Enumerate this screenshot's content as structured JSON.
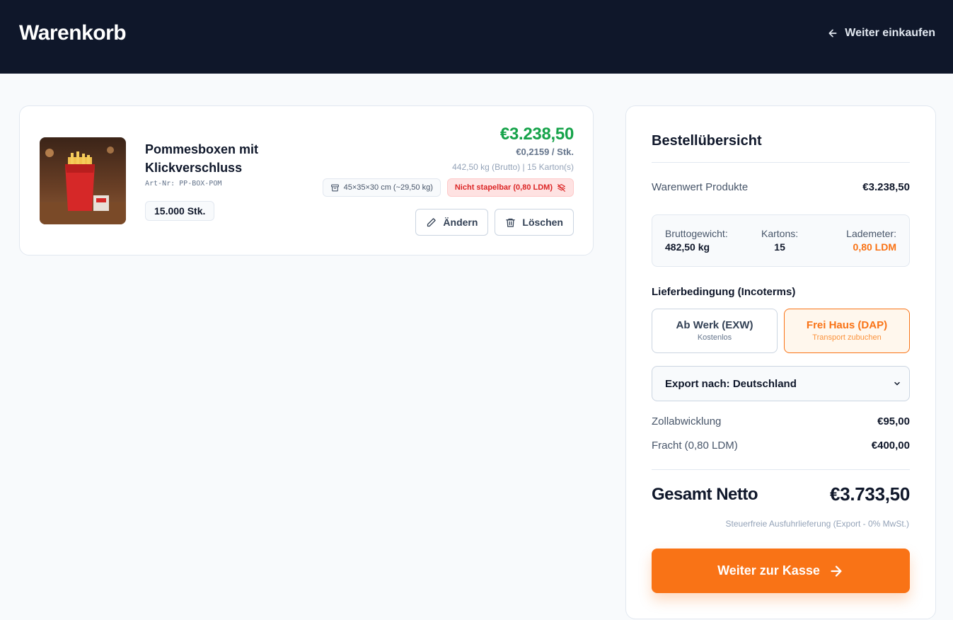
{
  "header": {
    "title": "Warenkorb",
    "back_label": "Weiter einkaufen"
  },
  "cart": {
    "items": [
      {
        "name": "Pommesboxen mit Klickverschluss",
        "sku": "Art-Nr: PP-BOX-POM",
        "quantity": "15.000 Stk.",
        "total_price": "€3.238,50",
        "unit_price": "€0,2159 / Stk.",
        "meta": "442,50 kg (Brutto) | 15 Karton(s)",
        "dimension_tag": "45×35×30 cm (~29,50 kg)",
        "warning_tag": "Nicht stapelbar (0,80 LDM)",
        "edit_label": "Ändern",
        "delete_label": "Löschen"
      }
    ]
  },
  "summary": {
    "title": "Bestellübersicht",
    "goods_label": "Warenwert Produkte",
    "goods_value": "€3.238,50",
    "stats": {
      "weight_label": "Bruttogewicht:",
      "weight_value": "482,50 kg",
      "cartons_label": "Kartons:",
      "cartons_value": "15",
      "ldm_label": "Lademeter:",
      "ldm_value": "0,80 LDM"
    },
    "incoterm_label": "Lieferbedingung (Incoterms)",
    "incoterms": [
      {
        "title": "Ab Werk (EXW)",
        "subtitle": "Kostenlos",
        "selected": false
      },
      {
        "title": "Frei Haus (DAP)",
        "subtitle": "Transport zubuchen",
        "selected": true
      }
    ],
    "export_select": "Export nach: Deutschland",
    "customs_label": "Zollabwicklung",
    "customs_value": "€95,00",
    "freight_label": "Fracht (0,80 LDM)",
    "freight_value": "€400,00",
    "total_label": "Gesamt Netto",
    "total_value": "€3.733,50",
    "tax_note": "Steuerfreie Ausfuhrlieferung (Export - 0% MwSt.)",
    "checkout_label": "Weiter zur Kasse"
  },
  "colors": {
    "header_bg": "#0f172a",
    "accent": "#f97316",
    "price_green": "#16a34a",
    "warning_red": "#dc2626"
  }
}
